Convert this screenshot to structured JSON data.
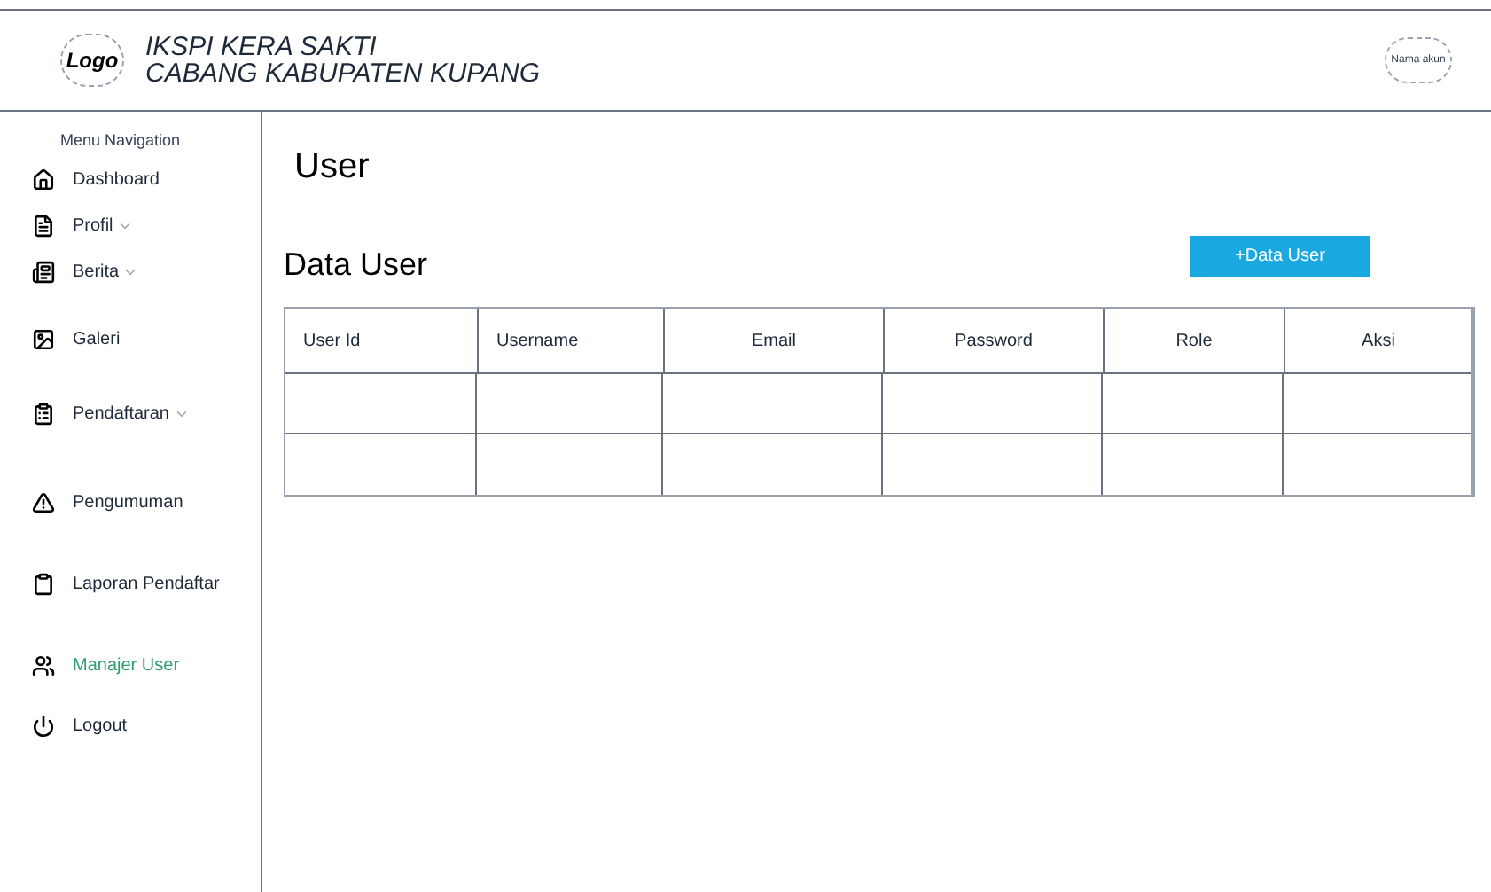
{
  "header": {
    "logo": "Logo",
    "title_lines": [
      "IKSPI KERA SAKTI",
      "CABANG KABUPATEN KUPANG"
    ],
    "account": "Nama akun"
  },
  "sidebar": {
    "title": "Menu Navigation",
    "items": [
      {
        "label": "Dashboard",
        "expandable": false,
        "selected": false
      },
      {
        "label": "Profil",
        "expandable": true,
        "selected": false
      },
      {
        "label": "Berita",
        "expandable": true,
        "selected": false
      },
      {
        "label": "Galeri",
        "expandable": false,
        "selected": false
      },
      {
        "label": "Pendaftaran",
        "expandable": true,
        "selected": false
      },
      {
        "label": "Pengumuman",
        "expandable": false,
        "selected": false
      },
      {
        "label": "Laporan Pendaftar",
        "expandable": false,
        "selected": false
      },
      {
        "label": "Manajer User",
        "expandable": false,
        "selected": true
      },
      {
        "label": "Logout",
        "expandable": false,
        "selected": false
      }
    ]
  },
  "page_title": "User",
  "section_title": "Data User",
  "add_button": "+Data User",
  "table": {
    "columns": [
      "User Id",
      "Username",
      "Email",
      "Password",
      "Role",
      "Aksi"
    ]
  }
}
